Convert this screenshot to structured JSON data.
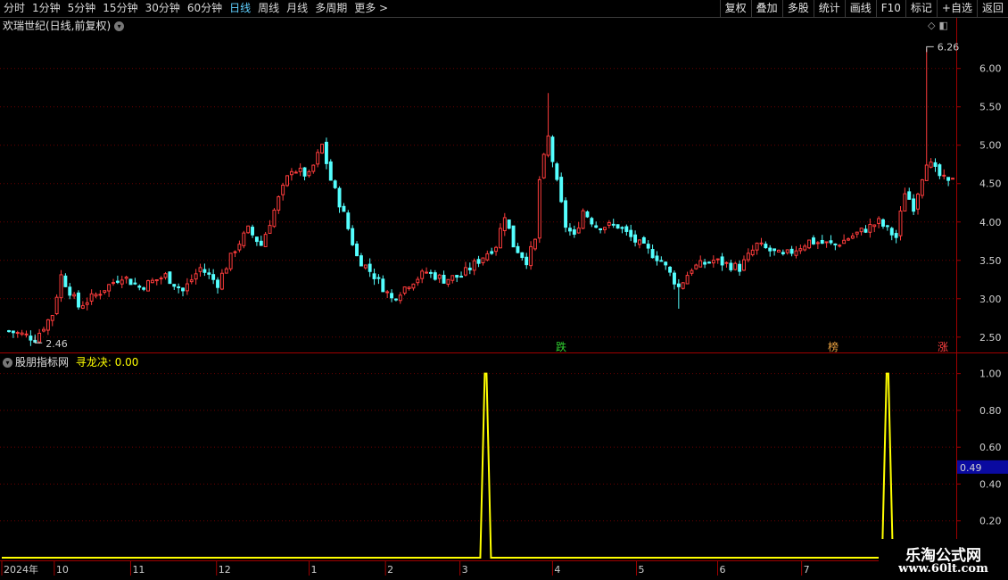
{
  "toolbar": {
    "period_tabs": [
      "分时",
      "1分钟",
      "5分钟",
      "15分钟",
      "30分钟",
      "60分钟",
      "日线",
      "周线",
      "月线",
      "多周期",
      "更多 >"
    ],
    "active_tab": "日线",
    "right_buttons": [
      "复权",
      "叠加",
      "多股",
      "统计",
      "画线",
      "F10",
      "标记",
      "+自选",
      "返回"
    ]
  },
  "main_chart": {
    "title": "欢瑞世纪(日线,前复权)",
    "y_ticks": [
      "6.00",
      "5.50",
      "5.00",
      "4.50",
      "4.00",
      "3.50",
      "3.00",
      "2.50"
    ],
    "high_label": "6.26",
    "low_label": "2.46",
    "markers": [
      {
        "text": "跌",
        "color": "#30d030"
      },
      {
        "text": "榜",
        "color": "#e8a040"
      },
      {
        "text": "涨",
        "color": "#ff4040"
      }
    ]
  },
  "sub_chart": {
    "name": "股朋指标网",
    "indicator_label": "寻龙决: 0.00",
    "y_ticks": [
      "1.00",
      "0.80",
      "0.60",
      "0.40",
      "0.20"
    ],
    "current_value": "0.49"
  },
  "x_axis": {
    "labels": [
      "2024年",
      "10",
      "11",
      "12",
      "1",
      "2",
      "3",
      "4",
      "5",
      "6",
      "7"
    ]
  },
  "watermark": {
    "title": "乐淘公式网",
    "url": "www.60lt.com"
  },
  "chart_data": {
    "type": "candlestick",
    "colors": {
      "up": "#ff3c3c",
      "down": "#54ffff",
      "indicator": "#ffff00"
    },
    "ylim_price": [
      2.3,
      6.45
    ],
    "ylim_indicator": [
      0,
      1.1
    ],
    "total_bars": 218,
    "price_close_series": [
      {
        "bar": 0,
        "close": 2.58
      },
      {
        "bar": 4,
        "close": 2.52
      },
      {
        "bar": 6,
        "close": 2.48
      },
      {
        "bar": 10,
        "close": 2.8
      },
      {
        "bar": 12,
        "close": 3.3
      },
      {
        "bar": 14,
        "close": 3.1
      },
      {
        "bar": 16,
        "close": 2.9
      },
      {
        "bar": 20,
        "close": 3.05
      },
      {
        "bar": 26,
        "close": 3.3
      },
      {
        "bar": 30,
        "close": 3.15
      },
      {
        "bar": 36,
        "close": 3.3
      },
      {
        "bar": 40,
        "close": 3.1
      },
      {
        "bar": 44,
        "close": 3.4
      },
      {
        "bar": 48,
        "close": 3.2
      },
      {
        "bar": 52,
        "close": 3.65
      },
      {
        "bar": 55,
        "close": 3.9
      },
      {
        "bar": 58,
        "close": 3.7
      },
      {
        "bar": 62,
        "close": 4.3
      },
      {
        "bar": 65,
        "close": 4.7
      },
      {
        "bar": 69,
        "close": 4.6
      },
      {
        "bar": 72,
        "close": 5.0
      },
      {
        "bar": 74,
        "close": 4.55
      },
      {
        "bar": 77,
        "close": 4.1
      },
      {
        "bar": 80,
        "close": 3.55
      },
      {
        "bar": 84,
        "close": 3.3
      },
      {
        "bar": 88,
        "close": 3.0
      },
      {
        "bar": 92,
        "close": 3.2
      },
      {
        "bar": 96,
        "close": 3.35
      },
      {
        "bar": 100,
        "close": 3.25
      },
      {
        "bar": 104,
        "close": 3.3
      },
      {
        "bar": 108,
        "close": 3.5
      },
      {
        "bar": 112,
        "close": 3.7
      },
      {
        "bar": 114,
        "close": 4.1
      },
      {
        "bar": 116,
        "close": 3.7
      },
      {
        "bar": 119,
        "close": 3.5
      },
      {
        "bar": 121,
        "close": 3.75
      },
      {
        "bar": 122,
        "close": 4.55
      },
      {
        "bar": 124,
        "close": 5.1
      },
      {
        "bar": 126,
        "close": 4.5
      },
      {
        "bar": 128,
        "close": 3.95
      },
      {
        "bar": 130,
        "close": 3.8
      },
      {
        "bar": 132,
        "close": 4.15
      },
      {
        "bar": 135,
        "close": 3.95
      },
      {
        "bar": 140,
        "close": 3.95
      },
      {
        "bar": 144,
        "close": 3.75
      },
      {
        "bar": 150,
        "close": 3.5
      },
      {
        "bar": 154,
        "close": 3.15
      },
      {
        "bar": 157,
        "close": 3.4
      },
      {
        "bar": 162,
        "close": 3.5
      },
      {
        "bar": 168,
        "close": 3.4
      },
      {
        "bar": 172,
        "close": 3.7
      },
      {
        "bar": 178,
        "close": 3.55
      },
      {
        "bar": 184,
        "close": 3.75
      },
      {
        "bar": 190,
        "close": 3.7
      },
      {
        "bar": 195,
        "close": 3.85
      },
      {
        "bar": 200,
        "close": 4.0
      },
      {
        "bar": 204,
        "close": 3.8
      },
      {
        "bar": 206,
        "close": 4.4
      },
      {
        "bar": 208,
        "close": 4.2
      },
      {
        "bar": 211,
        "close": 4.8
      },
      {
        "bar": 214,
        "close": 4.6
      },
      {
        "bar": 216,
        "close": 4.5
      },
      {
        "bar": 217,
        "close": 4.6
      }
    ],
    "indicator_spikes": [
      {
        "bar_fraction": 0.506,
        "value": 1.0
      },
      {
        "bar_fraction": 0.927,
        "value": 1.0
      }
    ]
  }
}
